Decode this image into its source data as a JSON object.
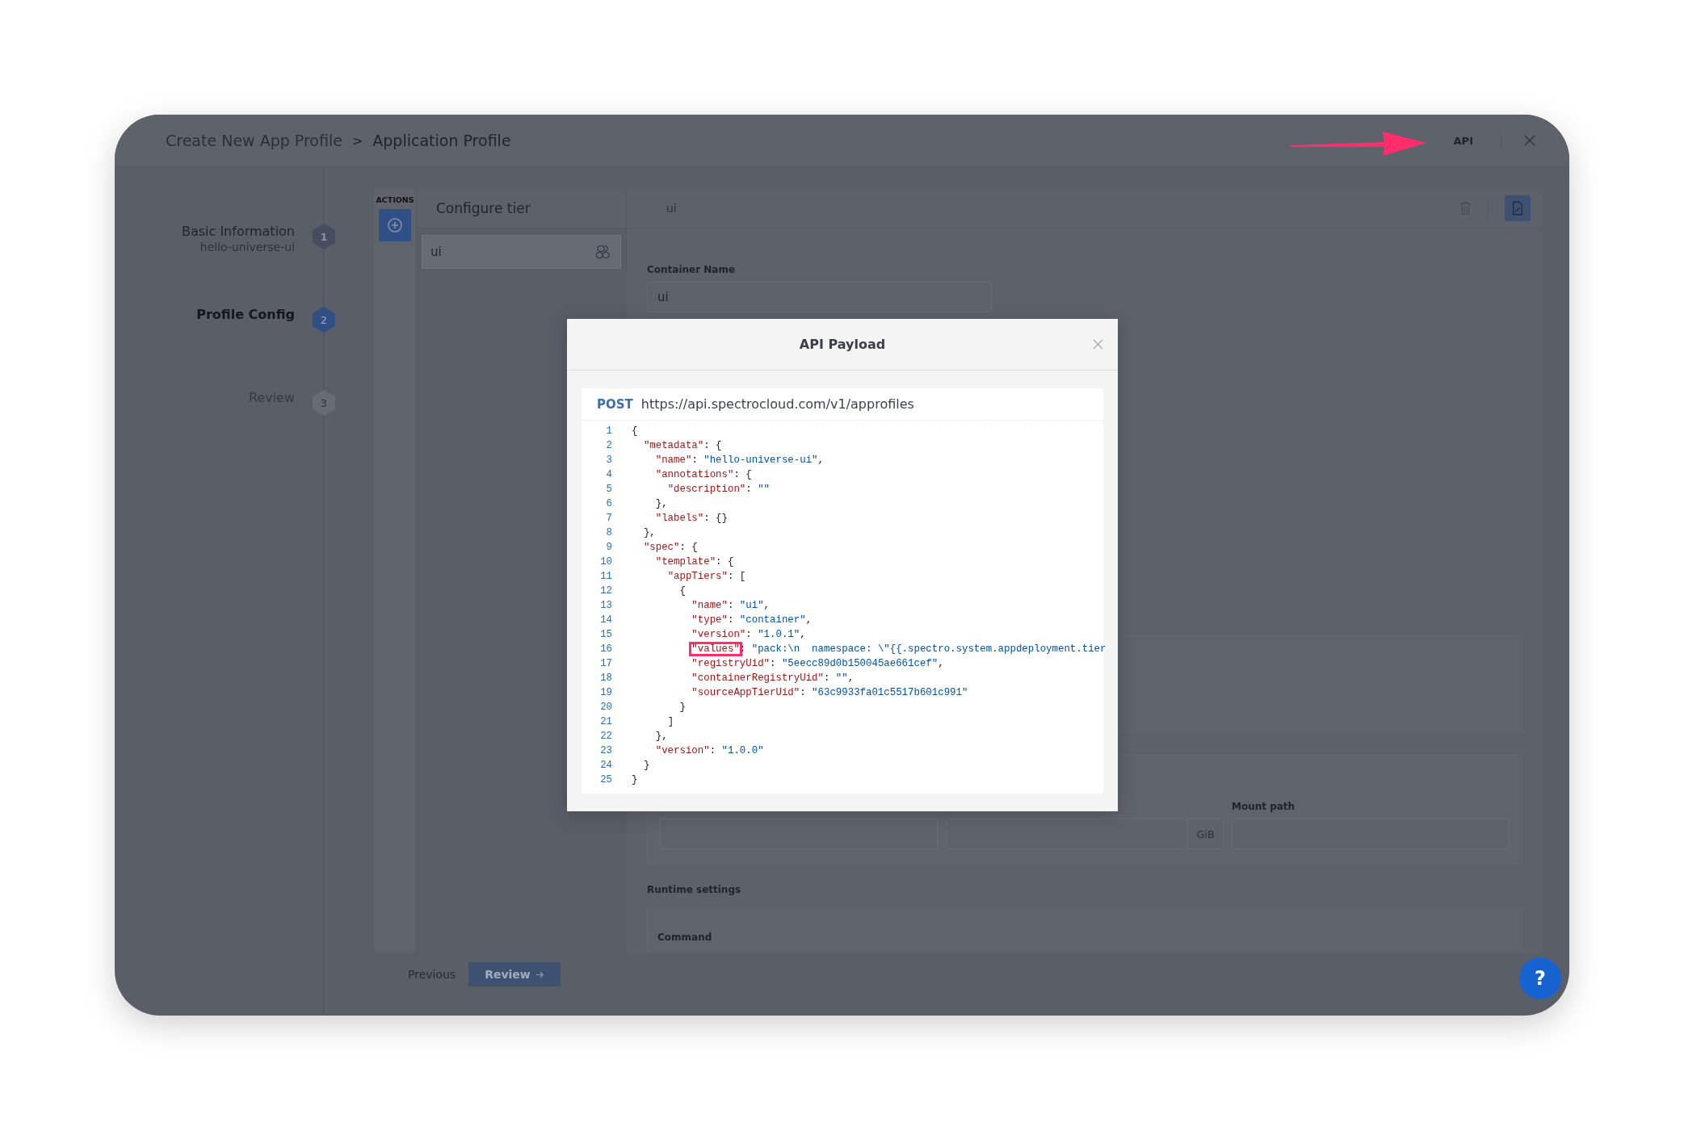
{
  "header": {
    "breadcrumb": [
      "Create New App Profile",
      "Application Profile"
    ],
    "separator": ">",
    "api_button": "API"
  },
  "steps": [
    {
      "title": "Basic Information",
      "subtitle": "hello-universe-ui",
      "number": "1",
      "completed": true,
      "selected": false
    },
    {
      "title": "Profile Config",
      "number": "2",
      "completed": false,
      "selected": true
    },
    {
      "title": "Review",
      "number": "3",
      "completed": false,
      "selected": false
    }
  ],
  "actions": {
    "label": "ACTIONS"
  },
  "tier_panel": {
    "title": "Configure tier",
    "tiers": [
      {
        "name": "ui",
        "selected": true
      }
    ]
  },
  "editor": {
    "tier_name": "ui",
    "container_name_label": "Container Name",
    "container_name": "ui",
    "size_unit": "GiB",
    "mount_path_label": "Mount path",
    "runtime_label": "Runtime settings",
    "command_label": "Command"
  },
  "footer": {
    "previous": "Previous",
    "review": "Review"
  },
  "help": "?",
  "modal": {
    "title": "API Payload",
    "method": "POST",
    "url": "https://api.spectrocloud.com/v1/approfiles",
    "lines": [
      {
        "no": "1",
        "highlighted": false,
        "tokens": [
          {
            "kind": "punct",
            "text": "{"
          }
        ]
      },
      {
        "no": "2",
        "highlighted": false,
        "tokens": [
          {
            "kind": "key",
            "text": "  \"metadata\""
          },
          {
            "kind": "punct",
            "text": ": {"
          }
        ]
      },
      {
        "no": "3",
        "highlighted": false,
        "tokens": [
          {
            "kind": "key",
            "text": "    \"name\""
          },
          {
            "kind": "punct",
            "text": ": "
          },
          {
            "kind": "string",
            "text": "\"hello-universe-ui\""
          },
          {
            "kind": "punct",
            "text": ","
          }
        ]
      },
      {
        "no": "4",
        "highlighted": false,
        "tokens": [
          {
            "kind": "key",
            "text": "    \"annotations\""
          },
          {
            "kind": "punct",
            "text": ": {"
          }
        ]
      },
      {
        "no": "5",
        "highlighted": false,
        "tokens": [
          {
            "kind": "key",
            "text": "      \"description\""
          },
          {
            "kind": "punct",
            "text": ": "
          },
          {
            "kind": "string",
            "text": "\"\""
          }
        ]
      },
      {
        "no": "6",
        "highlighted": false,
        "tokens": [
          {
            "kind": "punct",
            "text": "    },"
          }
        ]
      },
      {
        "no": "7",
        "highlighted": false,
        "tokens": [
          {
            "kind": "key",
            "text": "    \"labels\""
          },
          {
            "kind": "punct",
            "text": ": {}"
          }
        ]
      },
      {
        "no": "8",
        "highlighted": false,
        "tokens": [
          {
            "kind": "punct",
            "text": "  },"
          }
        ]
      },
      {
        "no": "9",
        "highlighted": false,
        "tokens": [
          {
            "kind": "key",
            "text": "  \"spec\""
          },
          {
            "kind": "punct",
            "text": ": {"
          }
        ]
      },
      {
        "no": "10",
        "highlighted": false,
        "tokens": [
          {
            "kind": "key",
            "text": "    \"template\""
          },
          {
            "kind": "punct",
            "text": ": {"
          }
        ]
      },
      {
        "no": "11",
        "highlighted": false,
        "tokens": [
          {
            "kind": "key",
            "text": "      \"appTiers\""
          },
          {
            "kind": "punct",
            "text": ": ["
          }
        ]
      },
      {
        "no": "12",
        "highlighted": false,
        "tokens": [
          {
            "kind": "punct",
            "text": "        {"
          }
        ]
      },
      {
        "no": "13",
        "highlighted": false,
        "tokens": [
          {
            "kind": "key",
            "text": "          \"name\""
          },
          {
            "kind": "punct",
            "text": ": "
          },
          {
            "kind": "string",
            "text": "\"ui\""
          },
          {
            "kind": "punct",
            "text": ","
          }
        ]
      },
      {
        "no": "14",
        "highlighted": false,
        "tokens": [
          {
            "kind": "key",
            "text": "          \"type\""
          },
          {
            "kind": "punct",
            "text": ": "
          },
          {
            "kind": "string",
            "text": "\"container\""
          },
          {
            "kind": "punct",
            "text": ","
          }
        ]
      },
      {
        "no": "15",
        "highlighted": false,
        "tokens": [
          {
            "kind": "key",
            "text": "          \"version\""
          },
          {
            "kind": "punct",
            "text": ": "
          },
          {
            "kind": "string",
            "text": "\"1.0.1\""
          },
          {
            "kind": "punct",
            "text": ","
          }
        ]
      },
      {
        "no": "16",
        "highlighted": true,
        "tokens": [
          {
            "kind": "key",
            "text": "          \"values\""
          },
          {
            "kind": "punct",
            "text": ": "
          },
          {
            "kind": "string",
            "text": "\"pack:\\n  namespace: \\\"{{.spectro.system.appdeployment.tier"
          }
        ]
      },
      {
        "no": "17",
        "highlighted": false,
        "tokens": [
          {
            "kind": "key",
            "text": "          \"registryUid\""
          },
          {
            "kind": "punct",
            "text": ": "
          },
          {
            "kind": "string",
            "text": "\"5eecc89d0b150045ae661cef\""
          },
          {
            "kind": "punct",
            "text": ","
          }
        ]
      },
      {
        "no": "18",
        "highlighted": false,
        "tokens": [
          {
            "kind": "key",
            "text": "          \"containerRegistryUid\""
          },
          {
            "kind": "punct",
            "text": ": "
          },
          {
            "kind": "string",
            "text": "\"\""
          },
          {
            "kind": "punct",
            "text": ","
          }
        ]
      },
      {
        "no": "19",
        "highlighted": false,
        "tokens": [
          {
            "kind": "key",
            "text": "          \"sourceAppTierUid\""
          },
          {
            "kind": "punct",
            "text": ": "
          },
          {
            "kind": "string",
            "text": "\"63c9933fa01c5517b601c991\""
          }
        ]
      },
      {
        "no": "20",
        "highlighted": false,
        "tokens": [
          {
            "kind": "punct",
            "text": "        }"
          }
        ]
      },
      {
        "no": "21",
        "highlighted": false,
        "tokens": [
          {
            "kind": "punct",
            "text": "      ]"
          }
        ]
      },
      {
        "no": "22",
        "highlighted": false,
        "tokens": [
          {
            "kind": "punct",
            "text": "    },"
          }
        ]
      },
      {
        "no": "23",
        "highlighted": false,
        "tokens": [
          {
            "kind": "key",
            "text": "    \"version\""
          },
          {
            "kind": "punct",
            "text": ": "
          },
          {
            "kind": "string",
            "text": "\"1.0.0\""
          }
        ]
      },
      {
        "no": "24",
        "highlighted": false,
        "tokens": [
          {
            "kind": "punct",
            "text": "  }"
          }
        ]
      },
      {
        "no": "25",
        "highlighted": false,
        "tokens": [
          {
            "kind": "punct",
            "text": "}"
          }
        ]
      }
    ]
  }
}
